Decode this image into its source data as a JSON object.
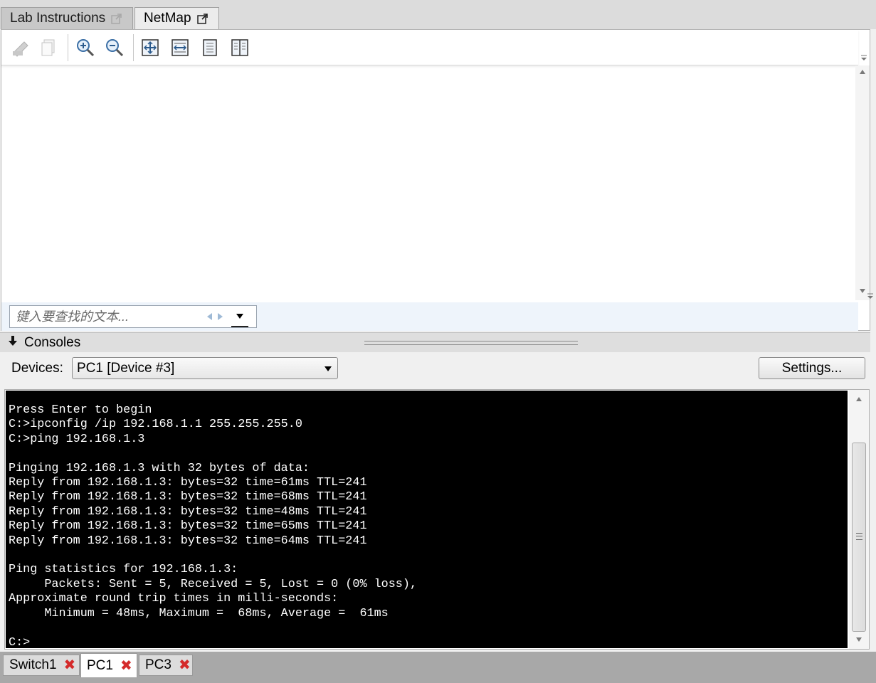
{
  "top_tabs": [
    {
      "label": "Lab Instructions",
      "icon": "popout-icon"
    },
    {
      "label": "NetMap",
      "icon": "popout-icon"
    }
  ],
  "toolbar": {
    "buttons": [
      "print-icon",
      "copy-icon",
      "zoom-in-icon",
      "zoom-out-icon",
      "fit-page-icon",
      "fit-width-icon",
      "single-page-icon",
      "two-page-icon"
    ]
  },
  "find": {
    "placeholder": "键入要查找的文本..."
  },
  "consoles": {
    "title": "Consoles",
    "devices_label": "Devices:",
    "selected_device": "PC1 [Device #3]",
    "settings_label": "Settings..."
  },
  "terminal": {
    "lines": [
      "Press Enter to begin",
      "C:>ipconfig /ip 192.168.1.1 255.255.255.0",
      "C:>ping 192.168.1.3",
      "",
      "Pinging 192.168.1.3 with 32 bytes of data:",
      "Reply from 192.168.1.3: bytes=32 time=61ms TTL=241",
      "Reply from 192.168.1.3: bytes=32 time=68ms TTL=241",
      "Reply from 192.168.1.3: bytes=32 time=48ms TTL=241",
      "Reply from 192.168.1.3: bytes=32 time=65ms TTL=241",
      "Reply from 192.168.1.3: bytes=32 time=64ms TTL=241",
      "",
      "Ping statistics for 192.168.1.3:",
      "     Packets: Sent = 5, Received = 5, Lost = 0 (0% loss),",
      "Approximate round trip times in milli-seconds:",
      "     Minimum = 48ms, Maximum =  68ms, Average =  61ms",
      "",
      "C:>"
    ]
  },
  "device_tabs": [
    {
      "label": "Switch1",
      "active": false
    },
    {
      "label": "PC1",
      "active": true
    },
    {
      "label": "PC3",
      "active": false
    }
  ],
  "colors": {
    "terminal_bg": "#000000",
    "terminal_fg": "#ffffff",
    "close_x": "#d42a2a"
  }
}
